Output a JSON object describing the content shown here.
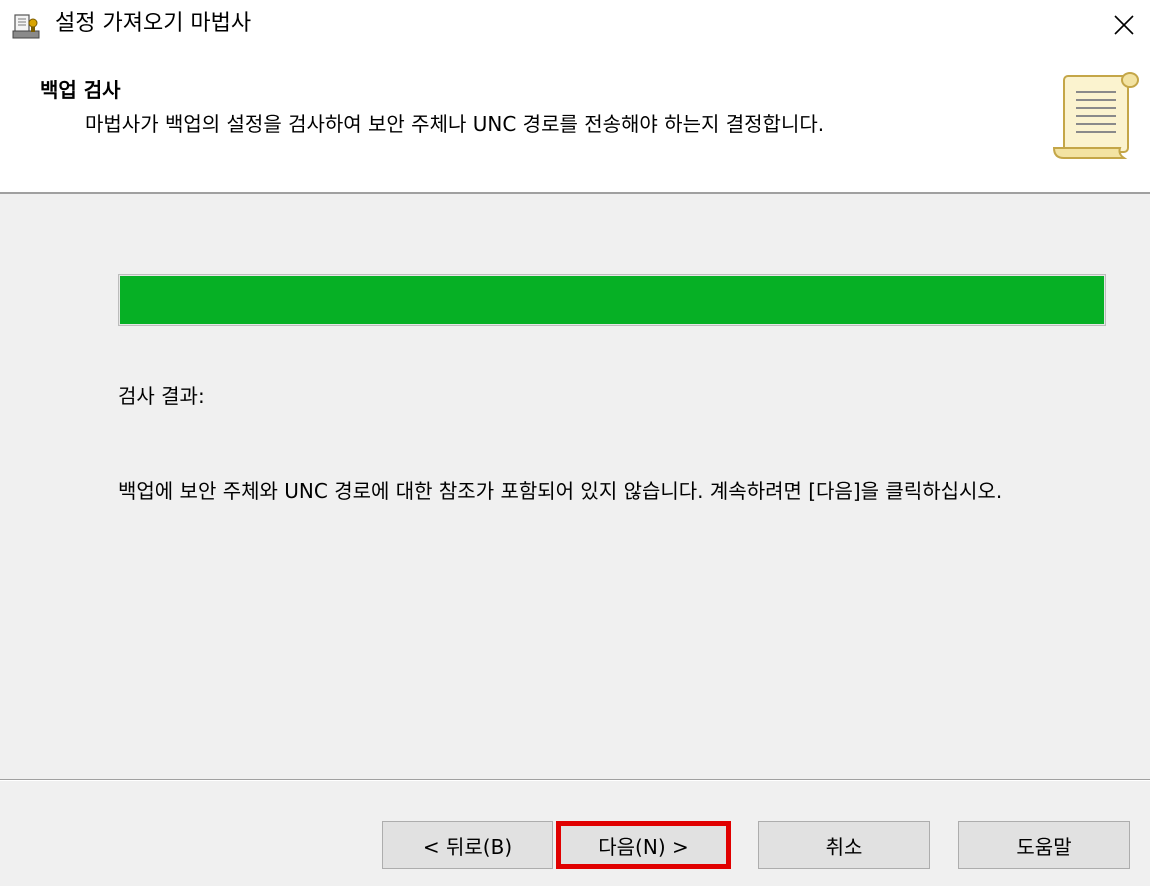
{
  "window": {
    "title": "설정 가져오기 마법사",
    "app_icon": "wizard-app-icon",
    "close_icon": "close-icon"
  },
  "header": {
    "title": "백업 검사",
    "description": "마법사가 백업의 설정을 검사하여 보안 주체나 UNC 경로를 전송해야 하는지 결정합니다.",
    "icon": "scroll-icon"
  },
  "main": {
    "progress": {
      "percent": 100,
      "color": "#06b025"
    },
    "result_label": "검사 결과:",
    "result_message": "백업에 보안 주체와 UNC 경로에 대한 참조가 포함되어 있지 않습니다. 계속하려면 [다음]을 클릭하십시오."
  },
  "buttons": {
    "back": "< 뒤로(B)",
    "next": "다음(N) >",
    "cancel": "취소",
    "help": "도움말"
  },
  "highlight_color": "#e00000"
}
